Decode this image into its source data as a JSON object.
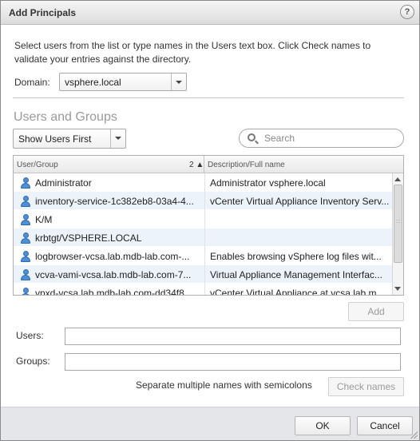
{
  "dialog": {
    "title": "Add Principals",
    "help_label": "?"
  },
  "instructions": "Select users from the list or type names in the Users text box. Click Check names to validate your entries against the directory.",
  "domain": {
    "label": "Domain:",
    "value": "vsphere.local"
  },
  "section_title": "Users and Groups",
  "filter": {
    "value": "Show Users First"
  },
  "search": {
    "placeholder": "Search"
  },
  "grid": {
    "columns": {
      "user_group": "User/Group",
      "sort_indicator": "2 ▲",
      "description": "Description/Full name"
    },
    "rows": [
      {
        "name": "Administrator",
        "description": "Administrator vsphere.local"
      },
      {
        "name": "inventory-service-1c382eb8-03a4-4...",
        "description": "vCenter Virtual Appliance Inventory Serv..."
      },
      {
        "name": "K/M",
        "description": ""
      },
      {
        "name": "krbtgt/VSPHERE.LOCAL",
        "description": ""
      },
      {
        "name": "logbrowser-vcsa.lab.mdb-lab.com-...",
        "description": "Enables browsing vSphere log files wit..."
      },
      {
        "name": "vcva-vami-vcsa.lab.mdb-lab.com-7...",
        "description": "Virtual Appliance Management Interfac..."
      },
      {
        "name": "vpxd-vcsa.lab.mdb-lab.com-dd34f8...",
        "description": "vCenter Virtual Appliance at vcsa.lab.m..."
      }
    ],
    "scroll_grip": "::"
  },
  "add_button": "Add",
  "users": {
    "label": "Users:",
    "value": ""
  },
  "groups": {
    "label": "Groups:",
    "value": ""
  },
  "hint": "Separate multiple names with semicolons",
  "check_names_button": "Check names",
  "ok_button": "OK",
  "cancel_button": "Cancel"
}
